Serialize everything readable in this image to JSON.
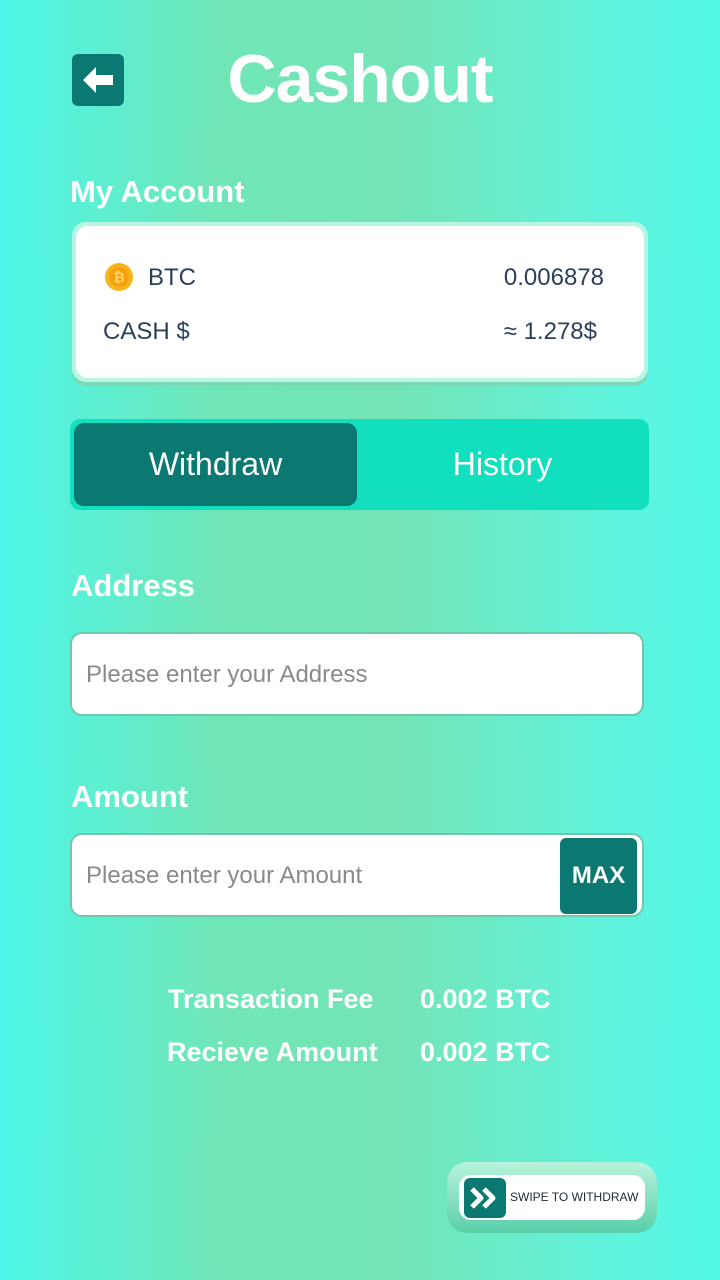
{
  "header": {
    "title": "Cashout"
  },
  "account": {
    "section_label": "My Account",
    "rows": [
      {
        "label": "BTC",
        "value": "0.006878",
        "icon": "bitcoin-coin-icon"
      },
      {
        "label": "CASH $",
        "value": "≈ 1.278$"
      }
    ]
  },
  "tabs": {
    "active": "Withdraw",
    "inactive": "History"
  },
  "address": {
    "label": "Address",
    "placeholder": "Please enter your Address",
    "value": ""
  },
  "amount": {
    "label": "Amount",
    "placeholder": "Please enter your Amount",
    "value": "",
    "max_label": "MAX"
  },
  "fees": [
    {
      "label": "Transaction Fee",
      "value": "0.002 BTC"
    },
    {
      "label": "Recieve Amount",
      "value": "0.002 BTC"
    }
  ],
  "swipe": {
    "label": "SWIPE TO WITHDRAW"
  },
  "colors": {
    "accent": "#0b7872",
    "tab_bar": "#11dfbe",
    "coin": "#f7b51c"
  }
}
